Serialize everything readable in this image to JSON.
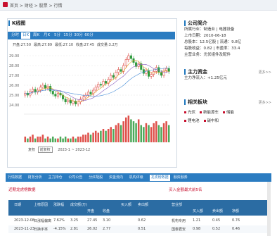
{
  "breadcrumb": {
    "text": "首页 > 财经 > 股票 > 行情"
  },
  "chart_panel": {
    "title": "K线图",
    "tabs": [
      "分时",
      "日K",
      "周K",
      "月K",
      "5分",
      "15分",
      "30分",
      "60分"
    ],
    "active_tab": 1,
    "stats": [
      "开盘:27.50",
      "最高:27.89",
      "最低:27.10",
      "收盘:27.45",
      "成交量:3.2万"
    ],
    "bottom_controls": {
      "label": "复权",
      "selected": "前复权",
      "range": "2023-1 ~ 2023-12"
    }
  },
  "chart_data": {
    "type": "candlestick",
    "price_ticks": [
      "29.00",
      "28.00",
      "27.00",
      "26.00",
      "25.00",
      "24.00"
    ],
    "ylim": [
      23.5,
      29.5
    ],
    "closes": [
      25.2,
      25.0,
      25.4,
      25.6,
      25.3,
      25.5,
      25.8,
      26.0,
      25.7,
      25.9,
      25.4,
      25.1,
      24.9,
      25.2,
      25.0,
      24.6,
      24.3,
      24.5,
      24.2,
      24.4,
      24.1,
      24.3,
      24.6,
      24.8,
      25.0,
      25.3,
      25.1,
      25.5,
      25.8,
      26.1,
      26.0,
      26.4,
      26.2,
      26.6,
      27.0,
      26.8,
      27.3,
      27.6,
      27.4,
      28.0,
      28.6,
      29.0,
      28.7,
      28.3,
      27.9,
      28.2,
      27.6,
      27.2,
      27.5,
      26.9,
      27.1,
      27.4,
      27.8,
      27.3,
      27.0,
      27.5,
      27.7,
      27.4
    ],
    "volumes": [
      3,
      2,
      3,
      4,
      2,
      3,
      3,
      4,
      2,
      3,
      2,
      3,
      2,
      2,
      3,
      2,
      3,
      2,
      2,
      3,
      2,
      3,
      3,
      4,
      4,
      5,
      4,
      5,
      6,
      5,
      6,
      7,
      6,
      7,
      8,
      7,
      9,
      10,
      9,
      11,
      13,
      14,
      12,
      11,
      10,
      12,
      9,
      8,
      10,
      9,
      8,
      10,
      11,
      9,
      8,
      10,
      11,
      9
    ],
    "colors": {
      "up": "#d9322b",
      "down": "#2e9a3d",
      "ma1": "#e0a020",
      "ma2": "#8a5fbf",
      "ma3": "#4a90d9"
    }
  },
  "right": {
    "section1": {
      "title": "公司简介",
      "more": "",
      "lines": [
        "所属行业：制造业 | 电器设备",
        "上市日期：2010-06-18",
        "总股本：12.5亿股 | 流通：9.8亿",
        "每股收益：0.82 | 市盈率：33.4",
        "主营业务：光伏组件及配件"
      ]
    },
    "section2": {
      "title": "主力资金",
      "more": "更多>>",
      "lines": [
        "主力净流入：+1.25亿元"
      ]
    },
    "section3": {
      "title": "相关板块",
      "more": "更多>>",
      "items": [
        "光伏",
        "新能源车",
        "储能",
        "锂电池",
        "碳中和"
      ]
    }
  },
  "bottom": {
    "tabs": [
      "行情数据",
      "财务分析",
      "主力持仓",
      "公司公告",
      "分红配股",
      "资金流向",
      "机构评级",
      "龙虎榜数据",
      "融资融券"
    ],
    "active_tab": 7,
    "subhead_left": "近期龙虎榜数据",
    "subhead_right": "买入金额最大前5名",
    "header_top": [
      "日期",
      "上榜原因",
      "涨跌幅",
      "成交额(万)",
      "",
      "",
      "买入额",
      "卖出额",
      "",
      "营业部",
      "",
      "",
      ""
    ],
    "header_sub": [
      "",
      "",
      "",
      "",
      "开盘",
      "收盘",
      "",
      "",
      "",
      "",
      "买入额",
      "卖出额",
      "净额"
    ],
    "rows": [
      [
        "2023-12-08",
        "日涨幅偏离",
        "7.62%",
        "3.25",
        "27.45",
        "3.10",
        "",
        "0.62",
        "",
        "机构专用",
        "1.21",
        "0.45",
        "0.76"
      ],
      [
        "2023-11-23",
        "日换手率",
        "-4.15%",
        "2.81",
        "26.02",
        "2.77",
        "",
        "0.51",
        "",
        "国泰君安",
        "0.98",
        "0.52",
        "0.46"
      ]
    ]
  }
}
